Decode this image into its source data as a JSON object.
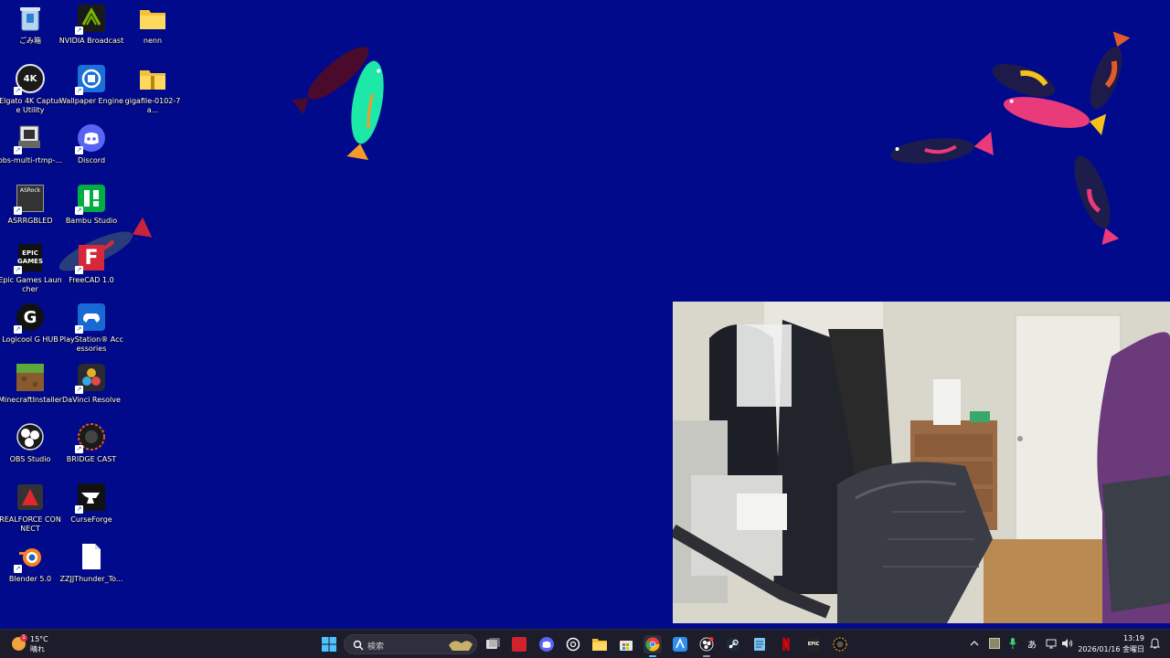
{
  "desktop": {
    "background_color": "#020a8c",
    "icons": [
      {
        "label": "ごみ箱",
        "icon": "recycle-bin-icon"
      },
      {
        "label": "NVIDIA Broadcast",
        "icon": "nvidia-broadcast-icon"
      },
      {
        "label": "nenn",
        "icon": "folder-icon"
      },
      {
        "label": "Elgato 4K Capture Utility",
        "icon": "elgato-4k-icon",
        "glyph": "4K"
      },
      {
        "label": "Wallpaper Engine",
        "icon": "wallpaper-engine-icon"
      },
      {
        "label": "gigafile-0102-7a...",
        "icon": "zip-folder-icon"
      },
      {
        "label": "obs-multi-rtmp-...",
        "icon": "installer-icon"
      },
      {
        "label": "Discord",
        "icon": "discord-icon"
      },
      {
        "label": "ASRRGBLED",
        "icon": "asrock-rgb-icon",
        "glyph": "ASRock"
      },
      {
        "label": "Bambu Studio",
        "icon": "bambu-studio-icon"
      },
      {
        "label": "Epic Games Launcher",
        "icon": "epic-games-icon",
        "glyph": "EPIC GAMES"
      },
      {
        "label": "FreeCAD 1.0",
        "icon": "freecad-icon",
        "glyph": "F"
      },
      {
        "label": "Logicool G HUB",
        "icon": "g-hub-icon",
        "glyph": "G"
      },
      {
        "label": "PlayStation® Accessories",
        "icon": "playstation-accessories-icon"
      },
      {
        "label": "MinecraftInstaller",
        "icon": "minecraft-icon"
      },
      {
        "label": "DaVinci Resolve",
        "icon": "davinci-resolve-icon"
      },
      {
        "label": "OBS Studio",
        "icon": "obs-studio-icon"
      },
      {
        "label": "BRIDGE CAST",
        "icon": "bridge-cast-icon"
      },
      {
        "label": "REALFORCE CONNECT",
        "icon": "realforce-icon"
      },
      {
        "label": "CurseForge",
        "icon": "curseforge-icon"
      },
      {
        "label": "Blender 5.0",
        "icon": "blender-icon"
      },
      {
        "label": "ZZJJThunder_To...",
        "icon": "file-icon"
      }
    ]
  },
  "taskbar": {
    "weather": {
      "temperature": "15°C",
      "condition": "晴れ",
      "alert_badge": "1"
    },
    "search": {
      "placeholder": "検索"
    },
    "apps": [
      "start-icon",
      "task-view-icon",
      "acrobat-icon",
      "discord-icon",
      "chatgpt-icon",
      "file-explorer-icon",
      "store-icon",
      "chrome-icon",
      "app-icon",
      "obs-icon",
      "steam-icon",
      "notepad-icon",
      "netflix-icon",
      "epic-games-icon",
      "bridge-cast-icon"
    ],
    "tray": {
      "ime": "あ",
      "time": "13:19",
      "date": "2026/01/16 金曜日"
    }
  },
  "colors": {
    "taskbar_bg": "#1c1c2a",
    "accent": "#4cc2ff",
    "discord": "#5865f2",
    "chrome_red": "#ea4335"
  }
}
